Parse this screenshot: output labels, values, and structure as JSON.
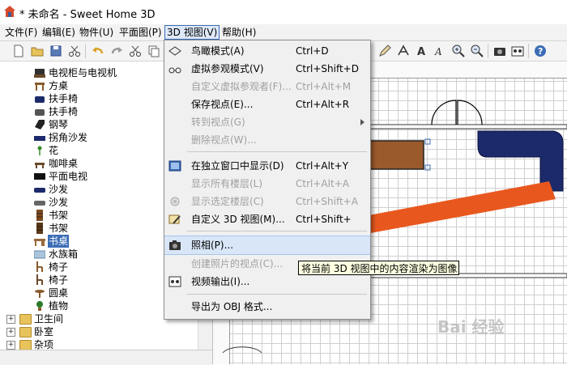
{
  "window": {
    "title": "* 未命名 - Sweet Home 3D"
  },
  "menubar": {
    "items": [
      {
        "label": "文件(F)"
      },
      {
        "label": "编辑(E)"
      },
      {
        "label": "物件(U)"
      },
      {
        "label": "平面图(P)"
      },
      {
        "label": "3D 视图(V)"
      },
      {
        "label": "帮助(H)"
      }
    ]
  },
  "toolbar": {
    "icons": [
      "new-file-icon",
      "open-folder-icon",
      "save-icon",
      "cut-icon",
      "undo-icon",
      "redo-icon",
      "cut-icon",
      "copy-icon",
      "paste-icon",
      "select-icon",
      "pan-icon",
      "wall-icon",
      "room-icon",
      "dimension-icon",
      "text-icon",
      "zoom-in-icon",
      "zoom-out-icon",
      "camera-icon",
      "video-icon",
      "help-icon"
    ]
  },
  "tree": {
    "items": [
      {
        "label": "电视柜与电视机",
        "icon": "tv-cabinet-icon",
        "color": "#303030"
      },
      {
        "label": "方桌",
        "icon": "square-table-icon",
        "color": "#8a5a2b"
      },
      {
        "label": "扶手椅",
        "icon": "armchair-icon",
        "color": "#1c2a6b"
      },
      {
        "label": "扶手椅",
        "icon": "armchair-icon",
        "color": "#555555"
      },
      {
        "label": "钢琴",
        "icon": "piano-icon",
        "color": "#222222"
      },
      {
        "label": "拐角沙发",
        "icon": "corner-sofa-icon",
        "color": "#1c2a6b"
      },
      {
        "label": "花",
        "icon": "flower-icon",
        "color": "#3a8a2a"
      },
      {
        "label": "咖啡桌",
        "icon": "coffee-table-icon",
        "color": "#6b4a2a"
      },
      {
        "label": "平面电视",
        "icon": "flat-tv-icon",
        "color": "#111111"
      },
      {
        "label": "沙发",
        "icon": "sofa-icon",
        "color": "#1c2a6b"
      },
      {
        "label": "沙发",
        "icon": "sofa-icon",
        "color": "#666666"
      },
      {
        "label": "书架",
        "icon": "bookshelf-icon",
        "color": "#7a4a22"
      },
      {
        "label": "书架",
        "icon": "bookshelf-icon",
        "color": "#5a3a1a"
      },
      {
        "label": "书桌",
        "icon": "desk-icon",
        "color": "#9a6a3a",
        "selected": true
      },
      {
        "label": "水族箱",
        "icon": "aquarium-icon",
        "color": "#6a8aa8"
      },
      {
        "label": "椅子",
        "icon": "chair-icon",
        "color": "#8a5a2b"
      },
      {
        "label": "椅子",
        "icon": "chair-icon",
        "color": "#6b4a2a"
      },
      {
        "label": "圆桌",
        "icon": "round-table-icon",
        "color": "#8a5a2b"
      },
      {
        "label": "植物",
        "icon": "plant-icon",
        "color": "#2a7a2a"
      }
    ],
    "categories": [
      {
        "label": "卫生间"
      },
      {
        "label": "卧室"
      },
      {
        "label": "杂项"
      }
    ]
  },
  "menu3d": {
    "items": [
      {
        "label": "鸟瞰模式(A)",
        "shortcut": "Ctrl+D",
        "icon": "aerial-view-icon",
        "enabled": true
      },
      {
        "label": "虚拟参观模式(V)",
        "shortcut": "Ctrl+Shift+D",
        "icon": "virtual-visit-icon",
        "enabled": true
      },
      {
        "label": "自定义虚拟参观者(F)...",
        "shortcut": "Ctrl+Alt+M",
        "icon": "",
        "enabled": false
      },
      {
        "label": "保存视点(E)...",
        "shortcut": "Ctrl+Alt+R",
        "icon": "",
        "enabled": true
      },
      {
        "label": "转到视点(G)",
        "shortcut": "",
        "icon": "",
        "enabled": false,
        "submenu": true
      },
      {
        "label": "删除视点(W)...",
        "shortcut": "",
        "icon": "",
        "enabled": false
      },
      {
        "label": "在独立窗口中显示(D)",
        "shortcut": "Ctrl+Alt+Y",
        "icon": "separate-window-icon",
        "enabled": true
      },
      {
        "label": "显示所有楼层(L)",
        "shortcut": "Ctrl+Alt+A",
        "icon": "",
        "enabled": false
      },
      {
        "label": "显示选定楼层(C)",
        "shortcut": "Ctrl+Shift+A",
        "icon": "selected-level-icon",
        "enabled": false
      },
      {
        "label": "自定义 3D 视图(M)...",
        "shortcut": "Ctrl+Shift+",
        "icon": "modify-3d-icon",
        "enabled": true
      },
      {
        "label": "照相(P)...",
        "shortcut": "",
        "icon": "camera-icon",
        "enabled": true,
        "hover": true
      },
      {
        "label": "创建照片的视点(C)...",
        "shortcut": "",
        "icon": "",
        "enabled": false
      },
      {
        "label": "视频输出(I)...",
        "shortcut": "",
        "icon": "video-icon",
        "enabled": true
      },
      {
        "label": "导出为 OBJ 格式...",
        "shortcut": "",
        "icon": "",
        "enabled": true
      }
    ]
  },
  "tooltip": {
    "text": "将当前 3D 视图中的内容渲染为图像"
  },
  "watermark": {
    "text": "Bai 经验"
  },
  "colors": {
    "accent": "#3c6db5",
    "sofa": "#1c2a6b",
    "desk": "#9a5a2c",
    "arrow": "#e8581e",
    "tooltip_bg": "#ffffe1"
  }
}
